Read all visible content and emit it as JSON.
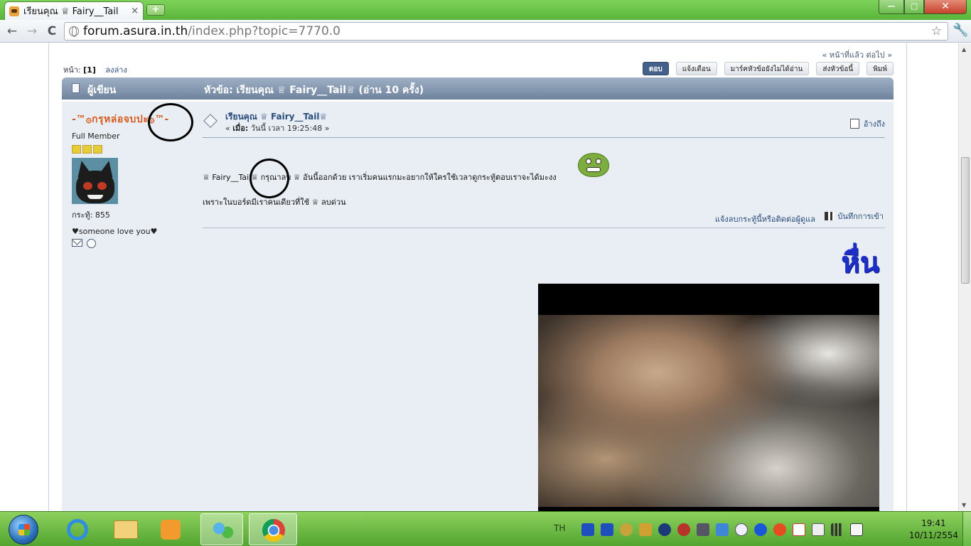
{
  "browser": {
    "tab_title": "เรียนคุณ ♕ Fairy__Tail",
    "tab_close": "×",
    "new_tab": "+",
    "url_host": "forum.asura.in.th",
    "url_path": "/index.php?topic=7770.0",
    "back": "←",
    "forward": "→",
    "reload": "C",
    "star": "☆",
    "wrench": "🔧",
    "min": "—",
    "max": "▢",
    "close": "✕"
  },
  "forum": {
    "page_nav_right": "« หน้าที่แล้ว ต่อไป »",
    "pages_label": "หน้า:",
    "pages_value": "[1]",
    "go_down": "ลงล่าง",
    "actions": {
      "reply": "ตอบ",
      "notify": "แจ้งเตือน",
      "mark_unread": "มาร์คหัวข้อยังไม่ได้อ่าน",
      "send_topic": "ส่งหัวข้อนี้",
      "print": "พิมพ์"
    },
    "header_author": "ผู้เขียน",
    "header_subject": "หัวข้อ: เรียนคุณ ♕ Fairy__Tail♕  (อ่าน 10 ครั้ง)"
  },
  "poster": {
    "name": "-™۞กรุหล่อจบปะ۞™-",
    "rank": "Full Member",
    "posts": "กระทู้: 855",
    "signature": "♥someone love you♥"
  },
  "post": {
    "title": "เรียนคุณ ♕ Fairy__Tail♕",
    "time_prefix": "«",
    "time_label": "เมื่อ:",
    "time_value": "วันนี้ เวลา 19:25:48 »",
    "quote": "อ้างถึง",
    "body_line1": "♕ Fairy__Tail♕  กรุณาลบ ♕ อันนี้ออกด้วย เราเริ่มคนแรกมะอยากให้ใครใช้เวลาดูกระทู้ตอบเราจะได้มะงง",
    "body_line2": "เพราะในบอร์ดมีเราคนเดียวที่ใช้  ♕ ลบด่วน",
    "report": "แจ้งลบกระทู้นี้หรือติดต่อผู้ดูแล",
    "logged": "บันทึกการเข้า",
    "sig_word": "หื่น"
  },
  "taskbar": {
    "lang": "TH",
    "time": "19:41",
    "date": "10/11/2554"
  },
  "colors": {
    "taskbar": "#58b43a",
    "catbar": "#7b8ea8",
    "poster_name": "#d55a1d",
    "link": "#2a4d7c",
    "sig_word": "#1c2fc9"
  }
}
